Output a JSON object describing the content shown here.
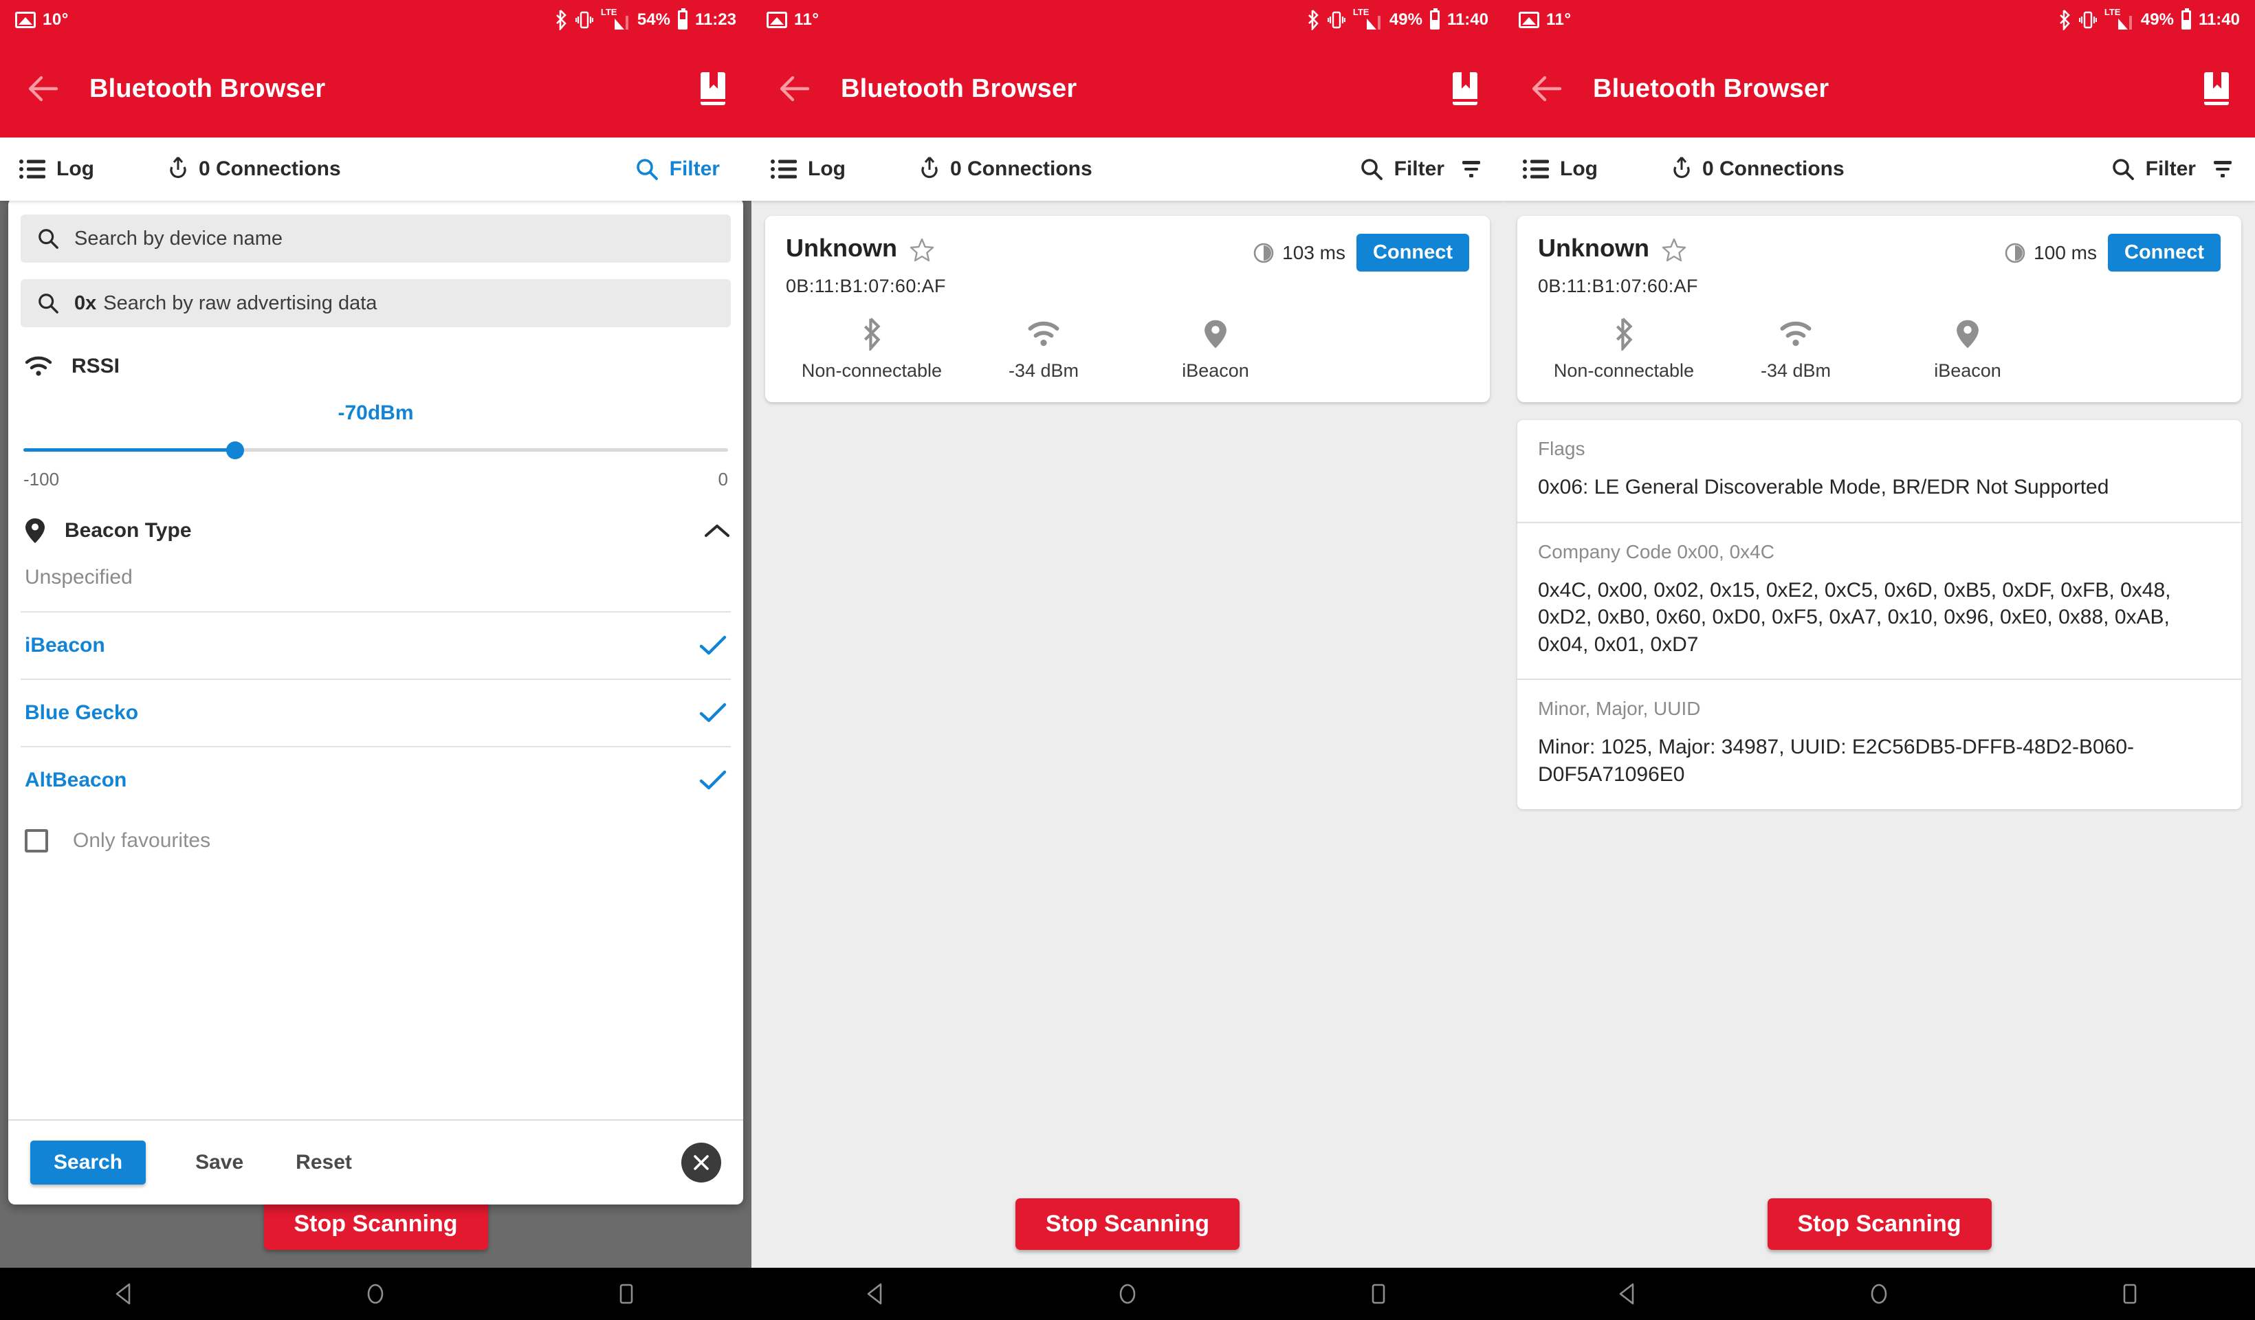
{
  "app": {
    "title": "Bluetooth Browser",
    "accent_blue": "#1184D6",
    "brand_red": "#E3122A"
  },
  "panels": [
    {
      "id": "filter-panel",
      "status": {
        "temp": "10°",
        "network": "LTE",
        "battery_pct": "54%",
        "time": "11:23"
      },
      "tabs": {
        "log": "Log",
        "connections": "0 Connections",
        "filter": "Filter"
      },
      "filter_sheet": {
        "search_name_placeholder": "Search by device name",
        "search_raw_prefix": "0x",
        "search_raw_placeholder": "Search by raw advertising data",
        "rssi_label": "RSSI",
        "rssi_value": "-70dBm",
        "rssi_min": "-100",
        "rssi_max": "0",
        "rssi_percent": 30,
        "beacon_label": "Beacon Type",
        "beacon_types": [
          {
            "name": "Unspecified",
            "selected": false
          },
          {
            "name": "iBeacon",
            "selected": true
          },
          {
            "name": "Blue Gecko",
            "selected": true
          },
          {
            "name": "AltBeacon",
            "selected": true
          }
        ],
        "only_favourites": "Only favourites",
        "only_favourites_checked": false,
        "search_button": "Search",
        "save_button": "Save",
        "reset_button": "Reset"
      },
      "stop_button": "Stop Scanning"
    },
    {
      "id": "device-list-panel",
      "status": {
        "temp": "11°",
        "network": "LTE",
        "battery_pct": "49%",
        "time": "11:40"
      },
      "tabs": {
        "log": "Log",
        "connections": "0 Connections",
        "filter": "Filter"
      },
      "device": {
        "name": "Unknown",
        "mac": "0B:11:B1:07:60:AF",
        "interval": "103 ms",
        "connect_label": "Connect",
        "connectable": "Non-connectable",
        "rssi": "-34 dBm",
        "beacon": "iBeacon"
      },
      "stop_button": "Stop Scanning"
    },
    {
      "id": "device-detail-panel",
      "status": {
        "temp": "11°",
        "network": "LTE",
        "battery_pct": "49%",
        "time": "11:40"
      },
      "tabs": {
        "log": "Log",
        "connections": "0 Connections",
        "filter": "Filter"
      },
      "device": {
        "name": "Unknown",
        "mac": "0B:11:B1:07:60:AF",
        "interval": "100 ms",
        "connect_label": "Connect",
        "connectable": "Non-connectable",
        "rssi": "-34 dBm",
        "beacon": "iBeacon"
      },
      "details": [
        {
          "key": "Flags",
          "value": "0x06: LE General Discoverable Mode, BR/EDR Not Supported"
        },
        {
          "key": "Company Code 0x00, 0x4C",
          "value": "0x4C, 0x00, 0x02, 0x15, 0xE2, 0xC5, 0x6D, 0xB5, 0xDF, 0xFB, 0x48, 0xD2, 0xB0, 0x60, 0xD0, 0xF5, 0xA7, 0x10, 0x96, 0xE0, 0x88, 0xAB, 0x04, 0x01, 0xD7"
        },
        {
          "key": "Minor, Major, UUID",
          "value": "Minor: 1025, Major: 34987, UUID: E2C56DB5-DFFB-48D2-B060-D0F5A71096E0"
        }
      ],
      "stop_button": "Stop Scanning"
    }
  ],
  "navbar": {
    "back": "back-triangle",
    "home": "home-circle",
    "recents": "recents-square"
  }
}
